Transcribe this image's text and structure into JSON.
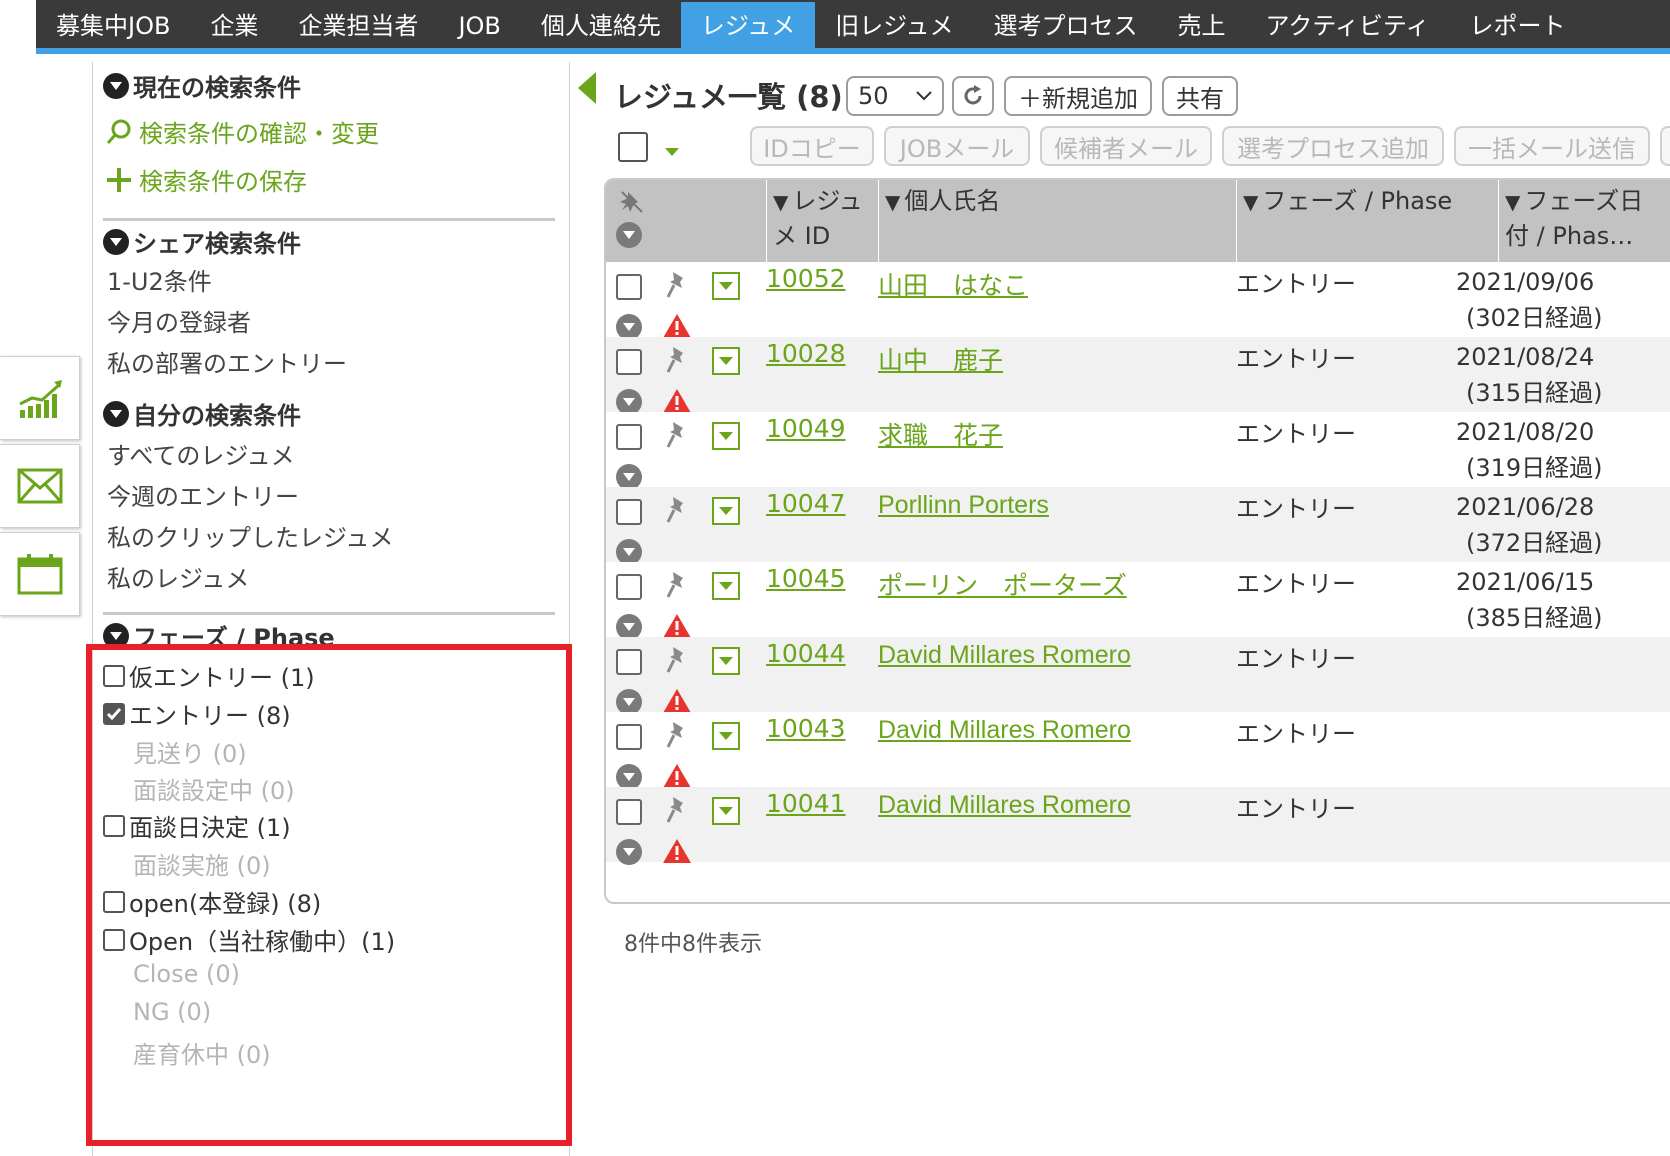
{
  "nav": {
    "items": [
      {
        "label": "募集中JOB",
        "active": false
      },
      {
        "label": "企業",
        "active": false
      },
      {
        "label": "企業担当者",
        "active": false
      },
      {
        "label": "JOB",
        "active": false
      },
      {
        "label": "個人連絡先",
        "active": false
      },
      {
        "label": "レジュメ",
        "active": true
      },
      {
        "label": "旧レジュメ",
        "active": false
      },
      {
        "label": "選考プロセス",
        "active": false
      },
      {
        "label": "売上",
        "active": false
      },
      {
        "label": "アクティビティ",
        "active": false
      },
      {
        "label": "レポート",
        "active": false
      }
    ]
  },
  "tools": {
    "icons": [
      "chart-icon",
      "mail-icon",
      "calendar-icon"
    ],
    "accent": "#6aa51c"
  },
  "sidebar": {
    "current": {
      "heading": "現在の検索条件",
      "check_label": "検索条件の確認・変更",
      "save_label": "検索条件の保存"
    },
    "shared": {
      "heading": "シェア検索条件",
      "items": [
        "1-U2条件",
        "今月の登録者",
        "私の部署のエントリー"
      ]
    },
    "mine": {
      "heading": "自分の検索条件",
      "items": [
        "すべてのレジュメ",
        "今週のエントリー",
        "私のクリップしたレジュメ",
        "私のレジュメ"
      ]
    },
    "phase": {
      "heading": "フェーズ / Phase",
      "items": [
        {
          "label": "仮エントリー (1)",
          "checked": false,
          "enabled": true
        },
        {
          "label": "エントリー (8)",
          "checked": true,
          "enabled": true
        },
        {
          "label": "見送り (0)",
          "checked": false,
          "enabled": false
        },
        {
          "label": "面談設定中 (0)",
          "checked": false,
          "enabled": false
        },
        {
          "label": "面談日決定 (1)",
          "checked": false,
          "enabled": true
        },
        {
          "label": "面談実施 (0)",
          "checked": false,
          "enabled": false
        },
        {
          "label": "open(本登録) (8)",
          "checked": false,
          "enabled": true
        },
        {
          "label": "Open（当社稼働中）(1)",
          "checked": false,
          "enabled": true
        },
        {
          "label": "Close (0)",
          "checked": false,
          "enabled": false
        },
        {
          "label": "NG (0)",
          "checked": false,
          "enabled": false
        },
        {
          "label": "産育休中 (0)",
          "checked": false,
          "enabled": false
        }
      ],
      "highlight_color": "#e8202a"
    }
  },
  "main": {
    "title": "レジュメ一覧 (8)",
    "per_page": "50",
    "add_label": "＋新規追加",
    "share_label": "共有",
    "bulk_actions": [
      "IDコピー",
      "JOBメール",
      "候補者メール",
      "選考プロセス追加",
      "一括メール送信"
    ],
    "columns": {
      "resume_id": "レジュメ ID",
      "name": "個人氏名",
      "phase": "フェーズ / Phase",
      "phase_date": "フェーズ日付 / Phas…"
    },
    "rows": [
      {
        "id": "10052",
        "name": "山田　はなこ",
        "phase": "エントリー",
        "date": "2021/09/06",
        "elapsed": "(302日経過)",
        "warn": true
      },
      {
        "id": "10028",
        "name": "山中　鹿子",
        "phase": "エントリー",
        "date": "2021/08/24",
        "elapsed": "(315日経過)",
        "warn": true
      },
      {
        "id": "10049",
        "name": "求職　花子",
        "phase": "エントリー",
        "date": "2021/08/20",
        "elapsed": "(319日経過)",
        "warn": false
      },
      {
        "id": "10047",
        "name": "Porllinn Porters",
        "phase": "エントリー",
        "date": "2021/06/28",
        "elapsed": "(372日経過)",
        "warn": false
      },
      {
        "id": "10045",
        "name": "ポーリン　ポーターズ",
        "phase": "エントリー",
        "date": "2021/06/15",
        "elapsed": "(385日経過)",
        "warn": true
      },
      {
        "id": "10044",
        "name": "David Millares Romero",
        "phase": "エントリー",
        "date": "",
        "elapsed": "",
        "warn": true
      },
      {
        "id": "10043",
        "name": "David Millares Romero",
        "phase": "エントリー",
        "date": "",
        "elapsed": "",
        "warn": true
      },
      {
        "id": "10041",
        "name": "David Millares Romero",
        "phase": "エントリー",
        "date": "",
        "elapsed": "",
        "warn": true
      }
    ],
    "count_text": "8件中8件表示"
  }
}
